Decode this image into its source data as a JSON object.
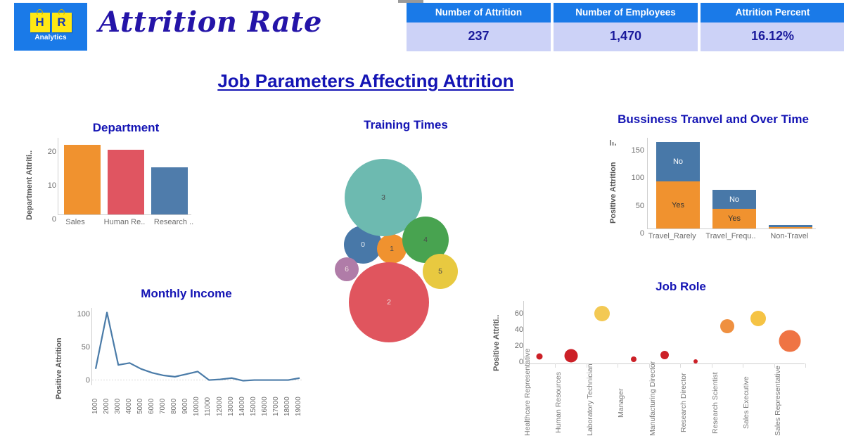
{
  "header": {
    "logo": {
      "tile_1": "H",
      "tile_2": "R",
      "caption": "Analytics",
      "bg_color": "#1a7ae8",
      "tile_color": "#ffe814"
    },
    "title": "Attrition Rate",
    "title_color": "#2414a8"
  },
  "kpis": [
    {
      "label": "Number of Attrition",
      "value": "237"
    },
    {
      "label": "Number of Employees",
      "value": "1,470"
    },
    {
      "label": "Attrition Percent",
      "value": "16.12%"
    }
  ],
  "section_title": "Job Parameters Affecting Attrition",
  "colors": {
    "accent_blue": "#1a7ae8",
    "navy": "#1414b4",
    "kpi_value_bg": "#ccd2f7",
    "orange": "#f0922f",
    "red": "#e05561",
    "steel_blue": "#4f7cab"
  },
  "chart_data": [
    {
      "type": "bar",
      "title": "Department",
      "xlabel": "",
      "ylabel": "Department Attriti..",
      "categories": [
        "Sales",
        "Human Re..",
        "Research .."
      ],
      "values": [
        20.8,
        19.2,
        14.0
      ],
      "colors": [
        "#f0922f",
        "#e05561",
        "#4f7cab"
      ],
      "yticks": [
        0,
        10,
        20
      ],
      "ylim": [
        0,
        23
      ],
      "grid": false,
      "legend": "none"
    },
    {
      "type": "bubble",
      "title": "Training Times",
      "xlabel": "",
      "ylabel": "",
      "labels": [
        "0",
        "1",
        "2",
        "3",
        "4",
        "5",
        "6"
      ],
      "bubbles": [
        {
          "label": "0",
          "color": "#4878a8",
          "cx": 64,
          "cy": 152,
          "r": 27
        },
        {
          "label": "1",
          "color": "#f0922f",
          "cx": 105,
          "cy": 158,
          "r": 21
        },
        {
          "label": "2",
          "color": "#e0555e",
          "cx": 101,
          "cy": 234,
          "r": 57
        },
        {
          "label": "3",
          "color": "#6dbab0",
          "cx": 93,
          "cy": 85,
          "r": 55
        },
        {
          "label": "4",
          "color": "#48a350",
          "cx": 153,
          "cy": 145,
          "r": 33
        },
        {
          "label": "5",
          "color": "#e8c940",
          "cx": 174,
          "cy": 190,
          "r": 25
        },
        {
          "label": "6",
          "color": "#b07ca8",
          "cx": 41,
          "cy": 187,
          "r": 17
        }
      ],
      "grid": false,
      "legend": "none"
    },
    {
      "type": "bar",
      "stacked": true,
      "title": "Bussiness Tranvel and Over Time",
      "xlabel": "",
      "ylabel": "Positive Attrition",
      "categories": [
        "Travel_Rarely",
        "Travel_Frequ..",
        "Non-Travel"
      ],
      "series": [
        {
          "name": "Yes",
          "color": "#f0922f",
          "values": [
            85,
            35,
            3
          ]
        },
        {
          "name": "No",
          "color": "#4878a8",
          "values": [
            71,
            35,
            3
          ]
        }
      ],
      "yticks": [
        0,
        50,
        100,
        150
      ],
      "ylim": [
        0,
        165
      ],
      "grid": false,
      "legend": "in-bar-labels"
    },
    {
      "type": "line",
      "title": "Monthly Income",
      "xlabel": "",
      "ylabel": "Positive Attrition",
      "x": [
        "1000",
        "2000",
        "3000",
        "4000",
        "5000",
        "6000",
        "7000",
        "8000",
        "9000",
        "10000",
        "11000",
        "12000",
        "13000",
        "14000",
        "15000",
        "16000",
        "17000",
        "18000",
        "19000"
      ],
      "values": [
        17,
        103,
        23,
        26,
        17,
        11,
        7,
        5,
        9,
        13,
        0,
        1,
        3,
        -1,
        0,
        0,
        0,
        0,
        3
      ],
      "line_color": "#4a7ba8",
      "yticks": [
        0,
        50,
        100
      ],
      "ylim": [
        -8,
        110
      ],
      "grid": false,
      "legend": "none"
    },
    {
      "type": "scatter",
      "title": "Job Role",
      "xlabel": "",
      "ylabel": "Positive Attriti..",
      "categories": [
        "Healthcare Representative",
        "Human Resources",
        "Laboratory Technician",
        "Manager",
        "Manufacturing Director",
        "Research Director",
        "Research Scientist",
        "Sales Executive",
        "Sales Representative"
      ],
      "values": [
        5,
        10,
        63,
        1,
        8,
        -3,
        47,
        57,
        33
      ],
      "sizes": [
        9,
        19,
        22,
        8,
        12,
        6,
        20,
        22,
        31
      ],
      "point_colors": [
        "#cc2027",
        "#cc2027",
        "#f3c954",
        "#cc2027",
        "#cc2027",
        "#cc2027",
        "#ef9040",
        "#f5c344",
        "#ef7444"
      ],
      "yticks": [
        0,
        20,
        40,
        60
      ],
      "ylim": [
        -8,
        70
      ],
      "grid": false,
      "legend": "none"
    }
  ]
}
